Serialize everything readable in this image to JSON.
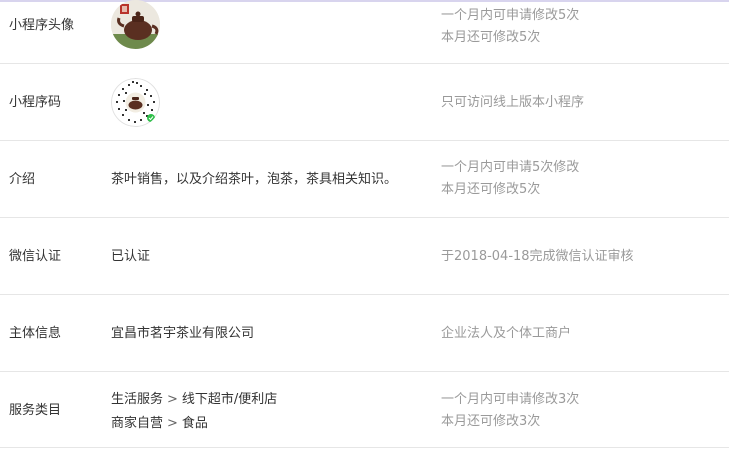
{
  "rows": {
    "avatar": {
      "label": "小程序头像",
      "note_line1": "一个月内可申请修改5次",
      "note_line2": "本月还可修改5次"
    },
    "qrcode": {
      "label": "小程序码",
      "note": "只可访问线上版本小程序"
    },
    "intro": {
      "label": "介绍",
      "value": "茶叶销售，以及介绍茶叶，泡茶，茶具相关知识。",
      "note_line1": "一个月内可申请5次修改",
      "note_line2": "本月还可修改5次"
    },
    "wechat_auth": {
      "label": "微信认证",
      "value": "已认证",
      "note": "于2018-04-18完成微信认证审核"
    },
    "entity": {
      "label": "主体信息",
      "value": "宜昌市茗宇茶业有限公司",
      "note": "企业法人及个体工商户"
    },
    "categories": {
      "label": "服务类目",
      "items": [
        {
          "primary": "生活服务",
          "separator": ">",
          "secondary": "线下超市/便利店"
        },
        {
          "primary": "商家自营",
          "separator": ">",
          "secondary": "食品"
        }
      ],
      "note_line1": "一个月内可申请修改3次",
      "note_line2": "本月还可修改3次"
    }
  }
}
